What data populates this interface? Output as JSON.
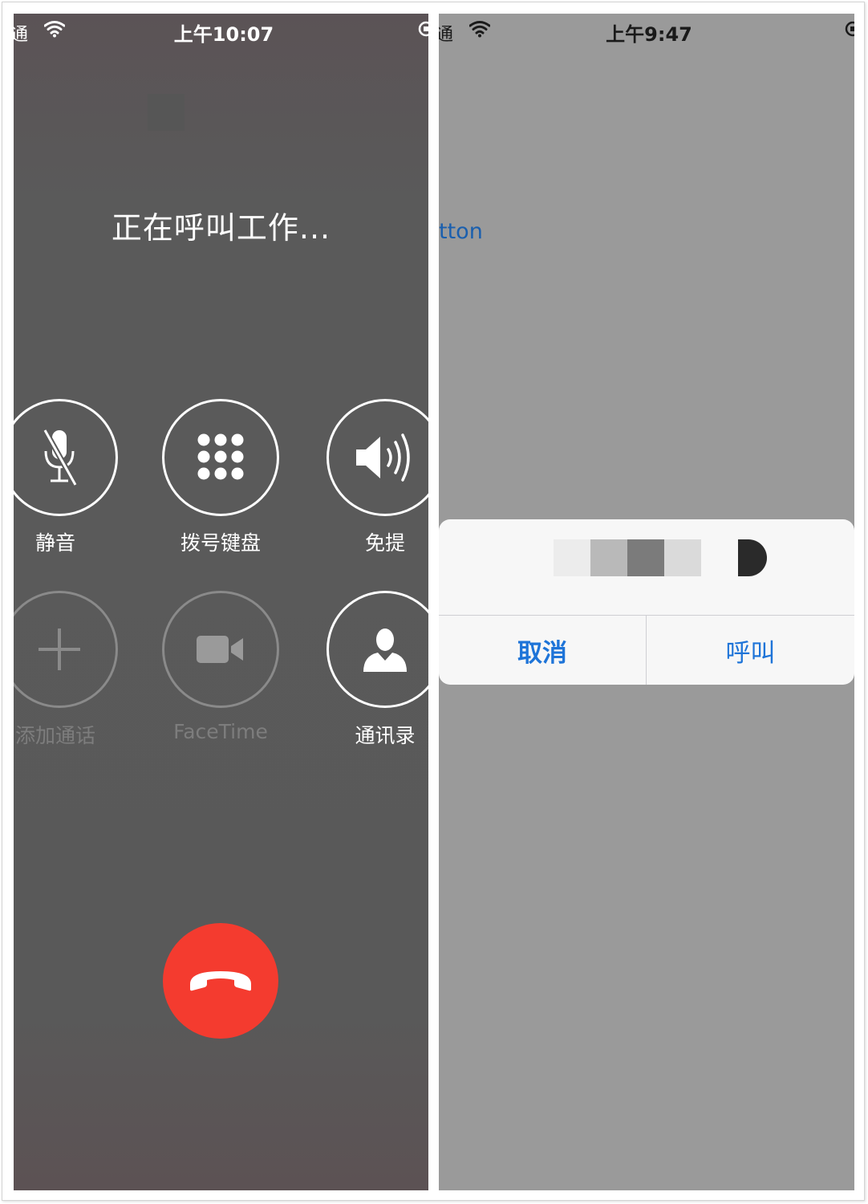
{
  "left_phone": {
    "status_bar": {
      "carrier": "通",
      "time": "上午10:07"
    },
    "call_status": "正在呼叫工作...",
    "controls": [
      {
        "label": "静音",
        "icon": "mic-muted-icon",
        "enabled": true
      },
      {
        "label": "拨号键盘",
        "icon": "keypad-icon",
        "enabled": true
      },
      {
        "label": "免提",
        "icon": "speaker-icon",
        "enabled": true
      },
      {
        "label": "添加通话",
        "icon": "plus-icon",
        "enabled": false
      },
      {
        "label": "FaceTime",
        "icon": "video-camera-icon",
        "enabled": false
      },
      {
        "label": "通讯录",
        "icon": "contact-icon",
        "enabled": true
      }
    ],
    "end_call_icon": "phone-hangup-icon",
    "colors": {
      "end_call": "#f43b2f",
      "background": "#5a5a5a"
    }
  },
  "right_phone": {
    "status_bar": {
      "carrier": "通",
      "time": "上午9:47"
    },
    "background_button_text": "tton",
    "alert": {
      "cancel_label": "取消",
      "call_label": "呼叫"
    },
    "colors": {
      "accent": "#1e74d8",
      "dim_background": "#9a9a9a"
    }
  }
}
